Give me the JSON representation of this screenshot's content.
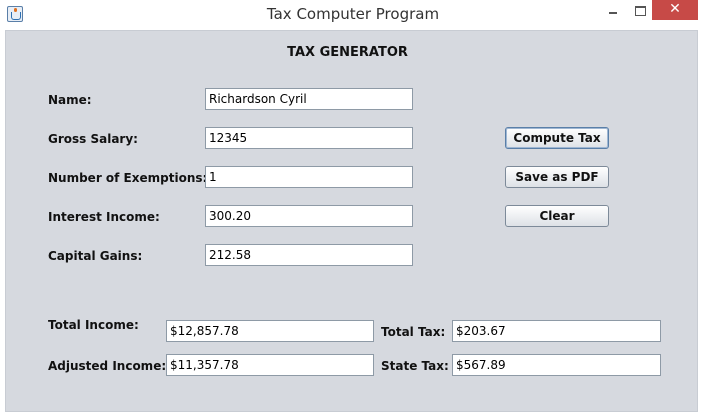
{
  "window": {
    "title": "Tax Computer Program",
    "icon": "java-cup-icon",
    "controls": {
      "minimize": "minimize-icon",
      "maximize": "maximize-icon",
      "close": "✕"
    }
  },
  "form": {
    "heading": "TAX GENERATOR",
    "name_label": "Name:",
    "name_value": "Richardson Cyril",
    "gross_salary_label": "Gross Salary:",
    "gross_salary_value": "12345",
    "exemptions_label": "Number of Exemptions:",
    "exemptions_value": "1",
    "interest_label": "Interest Income:",
    "interest_value": "300.20",
    "capital_gains_label": "Capital Gains:",
    "capital_gains_value": "212.58"
  },
  "buttons": {
    "compute": "Compute Tax",
    "save_pdf": "Save as PDF",
    "clear": "Clear"
  },
  "results": {
    "total_income_label": "Total Income:",
    "total_income_value": "$12,857.78",
    "adjusted_income_label": "Adjusted Income:",
    "adjusted_income_value": "$11,357.78",
    "total_tax_label": "Total Tax:",
    "total_tax_value": "$203.67",
    "state_tax_label": "State Tax:",
    "state_tax_value": "$567.89"
  },
  "colors": {
    "panel_bg": "#d6d9df",
    "close_button": "#c74a47"
  }
}
